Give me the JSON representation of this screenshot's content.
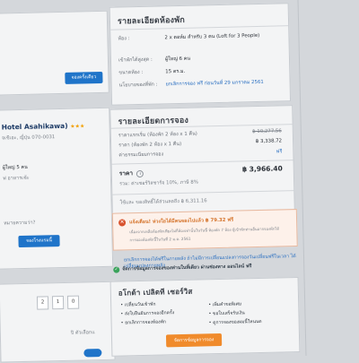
{
  "left": {
    "book_button": "จองครั้งเดียว",
    "hotel_name": "Hotel Asahikawa)",
    "stars": "★★★",
    "address": "จเซิเอะ, ญี่ปุ่น 070-0031",
    "guests": "ผู้ใหญ่ 5 คน",
    "wifi": "ฟ อาหารเช้ะ",
    "question": "หมายความว่า?",
    "continue_button": "จองโรงแรมนี้",
    "digits": [
      "2",
      "1",
      "0"
    ],
    "bottom_label": "ปิ ตัวเลือกแ"
  },
  "room": {
    "title": "รายละเอียดห้องพัก",
    "rows": [
      {
        "label": "ห้อง :",
        "value": "2 x ดอห์ม สำหรับ 3 คน (Loft for 3 People)"
      },
      {
        "label": "เข้าพักได้สูงสุด :",
        "value": "ผู้ใหญ่ 6 คน"
      },
      {
        "label": "ขนาดห้อง :",
        "value": "15 ตร.ม."
      },
      {
        "label": "นโยบายของที่พัก :",
        "value": "ยกเลิกการจอง ฟรี ก่อนวันที่ 29 มกราคม 2561"
      }
    ]
  },
  "booking": {
    "title": "รายละเอียดการจอง",
    "price_rows": [
      {
        "label": "ราคาแรกเริ่ม (ห้องพัก 2 ห้อง x 1 คืน)",
        "value": "฿ 10,277.56"
      },
      {
        "label": "ราคา (ห้องพัก 2 ห้อง x 1 คืน)",
        "value": "฿ 3,338.72"
      },
      {
        "label": "ค่าธรรมเนียมการจอง",
        "value": "ฟรี"
      }
    ],
    "total_label": "ราคา",
    "total_value": "฿ 3,966.40",
    "tax_note": "รวม: ค่าเซอร์วิสชาร์จ 10%, ภาษี 8%",
    "points_note": "ใช้และ ของสิทธิ์ได้ส่วนลดถึง ฿ 6,311.16"
  },
  "alert": {
    "headline": "แจ้งเตือน! ห่วงใยได้มีคนจองไปแล้ว ฿ 79.32 ฟรี",
    "line1": "เนื่องจากเหลือห้องพักเพียงไม่กี่ห้องเท่านั้นในวันนี้ ห้องพัก 7 ห้อง ผู้เข้าพักท่านอื่นอาจจองพักได้",
    "line2": "การจองห้องพักนี้ในวันที่ 2 ม.ค. 2561"
  },
  "notes": {
    "free_cancel": "ยกเลิกการจองได้ฟรีในภายหลัง ถ้าไม่มีการเปลี่ยนแปลงการจองวันเปลี่ยนฟรีในเวลา ได้เปลี่ยนแปลงภายหลัง",
    "no_card": "จัดการข้อมูลการจองของท่านในที่เดียว ผ่านช่องทาง ออนไลน์ ฟรี"
  },
  "benefits": {
    "title": "อโกด้า เปลิดที เซอร์วิส",
    "left_items": [
      "เปลี่ยนวันเข้าพัก",
      "ส่งใบยืนยันการจองอีกครั้ง",
      "ยกเลิกการจองห้องพัก"
    ],
    "right_items": [
      "เพิ่มคำขอพิเศษ",
      "ขอใบเสร็จรับเงิน",
      "ดูการจองของผมนี้ใหนนด"
    ],
    "manage_button": "จัดการข้อมูลการจอง"
  },
  "colors": {
    "accent_blue": "#1f74c9",
    "accent_orange": "#f08b2c",
    "alert_red": "#d8532f",
    "success_green": "#3aa35b"
  }
}
